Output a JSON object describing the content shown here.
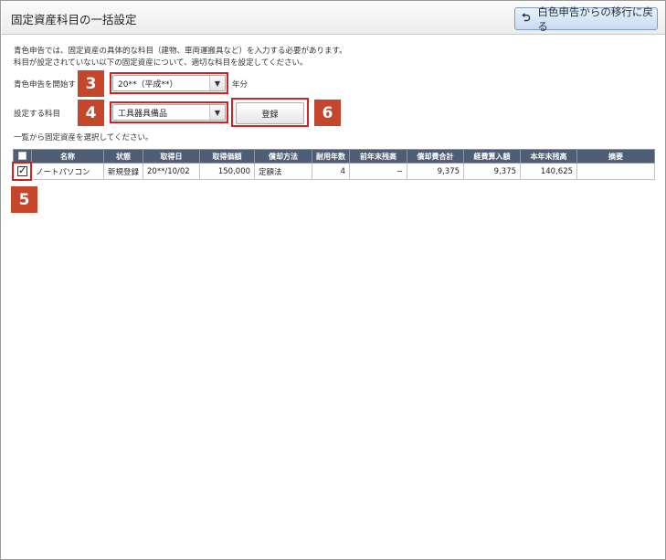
{
  "header": {
    "title": "固定資産科目の一括設定",
    "back_button_label": "白色申告からの移行に戻る",
    "back_icon": "return-arrow-icon"
  },
  "intro": {
    "line1": "青色申告では、固定資産の具体的な科目（建物、車両運搬具など）を入力する必要があります。",
    "line2": "科目が設定されていない以下の固定資産について、適切な科目を設定してください。"
  },
  "start_year": {
    "label": "青色申告を開始す",
    "value": "20**（平成**）",
    "suffix": "年分"
  },
  "account": {
    "label": "設定する科目",
    "value": "工具器具備品",
    "register_label": "登録"
  },
  "list_hint": "一覧から固定資産を選択してください。",
  "table": {
    "headers": [
      "",
      "名称",
      "状態",
      "取得日",
      "取得価額",
      "償却方法",
      "耐用年数",
      "前年末残高",
      "償却費合計",
      "経費算入額",
      "本年末残高",
      "摘要"
    ],
    "rows": [
      {
        "checked": true,
        "name": "ノートパソコン",
        "status": "新規登録",
        "acquired": "20**/10/02",
        "cost": "150,000",
        "method": "定額法",
        "life": "4",
        "prev_balance": "−",
        "depreciation_total": "9,375",
        "expense": "9,375",
        "year_end_balance": "140,625",
        "note": ""
      }
    ]
  },
  "badges": {
    "b3": "3",
    "b4": "4",
    "b5": "5",
    "b6": "6"
  },
  "colors": {
    "badge": "#c4472c",
    "highlight": "#d62020",
    "table_header": "#4f5d75"
  }
}
